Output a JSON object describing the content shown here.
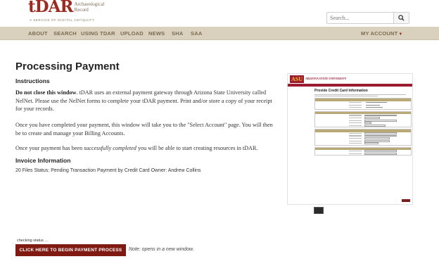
{
  "header": {
    "logo_word": "tDAR",
    "logo_sub": "Archaeological Record",
    "tagline": "A SERVICE OF DIGITAL ANTIQUITY",
    "search_placeholder": "Search..."
  },
  "nav": {
    "items": [
      "ABOUT",
      "SEARCH",
      "USING TDAR",
      "UPLOAD",
      "NEWS",
      "SHA",
      "SAA"
    ],
    "account": "MY ACCOUNT"
  },
  "main": {
    "title": "Processing Payment",
    "instructions_heading": "Instructions",
    "p1_bold": "Do not close this window",
    "p1_rest": ". tDAR uses an external payment gateway through Arizona State University called NelNet. Please use the NelNet forms to complete your tDAR payment. Print and/or store a copy of your receipt for your records.",
    "p2": "Once you have completed your payment, this window will take you to the \"Select Account\" page. You will then be to create and manage your Billing Accounts.",
    "p3_a": "Once your payment has been ",
    "p3_em": "successfully completed",
    "p3_b": " you will be able to start creating resources in tDAR.",
    "invoice_heading": "Invoice Information",
    "invoice_line": "20 Files Status: Pending Transaction Payment by Credit Card Owner: Andrew Collins"
  },
  "preview": {
    "asu": "ASU",
    "university": "ARIZONA STATE UNIVERSITY",
    "form_title": "Provide Credit Card Information"
  },
  "footer": {
    "status": "checking status ...",
    "pay_button": "CLICK HERE TO BEGIN PAYMENT PROCESS",
    "note": "Note: opens in a new window."
  },
  "colors": {
    "brand": "#9b2a21",
    "nav_bg": "#d9d0bd",
    "button": "#7e1a12"
  }
}
